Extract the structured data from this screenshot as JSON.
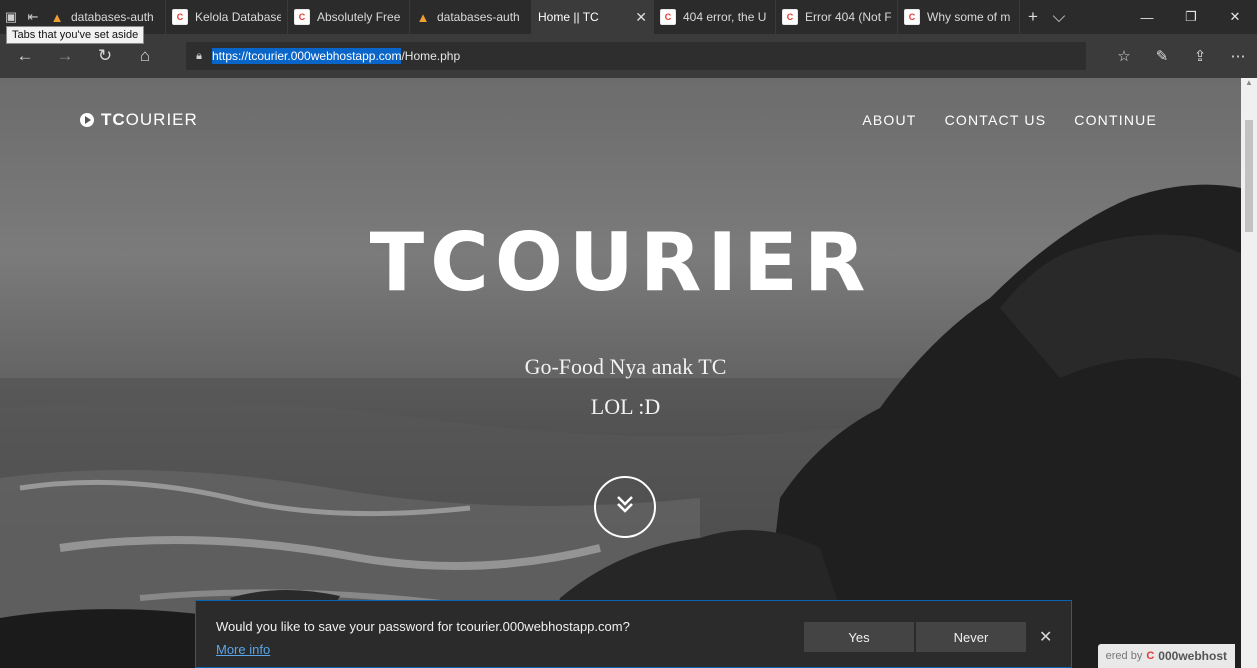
{
  "tabbar": {
    "tooltip": "Tabs that you've set aside",
    "tabs": [
      {
        "label": "databases-auth",
        "icon": "orange"
      },
      {
        "label": "Kelola Database",
        "icon": "red"
      },
      {
        "label": "Absolutely Free",
        "icon": "red"
      },
      {
        "label": "databases-auth",
        "icon": "orange"
      },
      {
        "label": "Home || TC",
        "icon": "page"
      },
      {
        "label": "404 error, the U",
        "icon": "red"
      },
      {
        "label": "Error 404 (Not F",
        "icon": "red"
      },
      {
        "label": "Why some of m",
        "icon": "red"
      }
    ],
    "active_close": "✕",
    "new_tab": "+",
    "tab_list": "⌵",
    "win_min": "—",
    "win_restore": "❐",
    "win_close": "✕"
  },
  "addressbar": {
    "url_selected": "https://tcourier.000webhostapp.com",
    "url_rest": "/Home.php"
  },
  "page": {
    "brand_bold": "TC",
    "brand_rest": "OURIER",
    "menu": [
      "ABOUT",
      "CONTACT US",
      "CONTINUE"
    ],
    "title": "TCOURIER",
    "subtitle1": "Go-Food Nya anak TC",
    "subtitle2": "LOL :D",
    "badge_prefix": "ered by",
    "badge_name": "000webhost"
  },
  "prompt": {
    "message": "Would you like to save your password for tcourier.000webhostapp.com?",
    "more_info": "More info",
    "yes": "Yes",
    "never": "Never",
    "close": "✕"
  }
}
